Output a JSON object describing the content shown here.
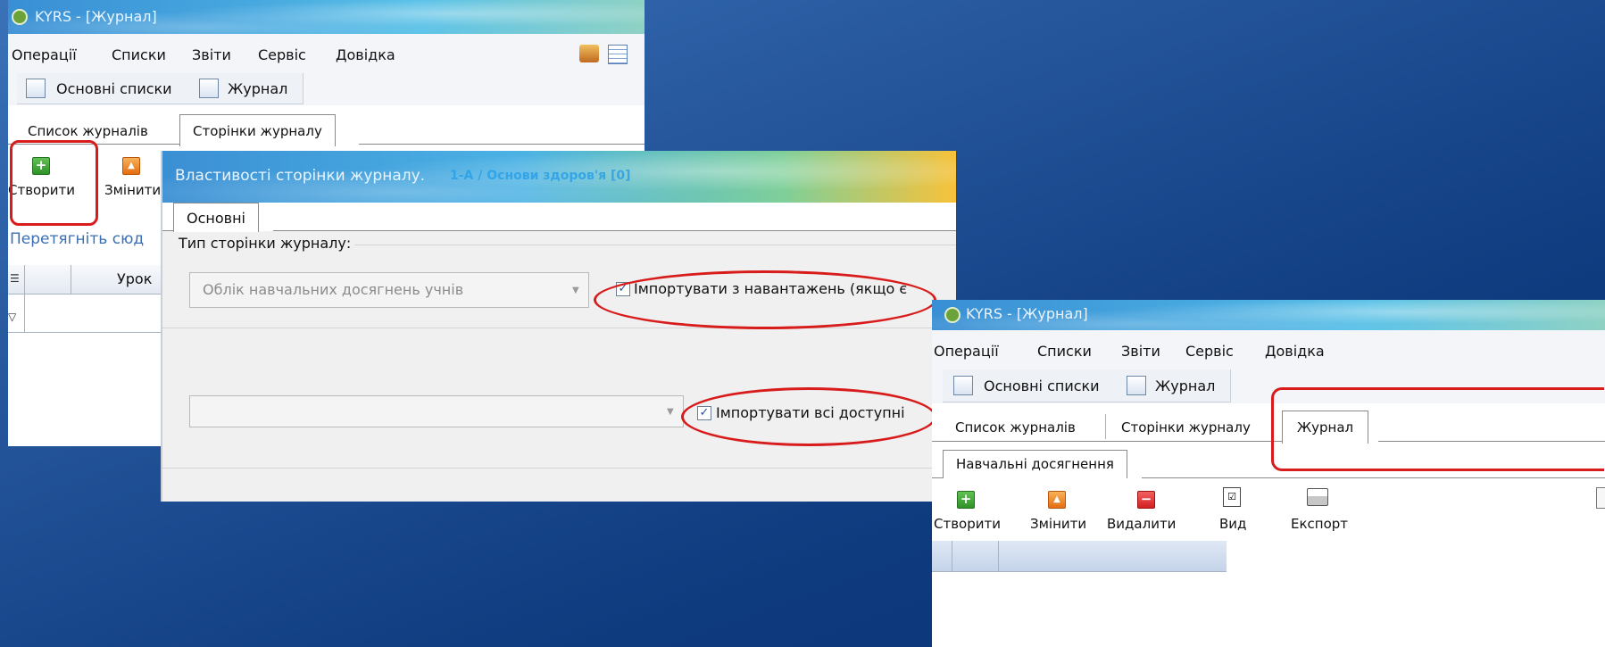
{
  "window1": {
    "title": "KYRS - [Журнал]",
    "menu": [
      "Операції",
      "Списки",
      "Звіти",
      "Сервіс",
      "Довідка"
    ],
    "toolbar_items": [
      "Основні списки",
      "Журнал"
    ],
    "tabs": [
      "Список журналів",
      "Сторінки журналу"
    ],
    "active_tab": "Сторінки журналу",
    "buttons": [
      "Створити",
      "Змінити"
    ],
    "drag_hint": "Перетягніть сюд",
    "column_header": "Урок"
  },
  "dialog": {
    "title": "Властивості сторінки журналу.",
    "title_suffix": "1-А / Основи здоров'я [0]",
    "tab": "Основні",
    "page_type_label": "Тип сторінки журналу:",
    "page_type_value": "Облік навчальних досягнень учнів",
    "checkbox_import_loads": "Імпортувати з навантажень (якщо є",
    "checkbox_import_all": "Імпортувати всі доступні",
    "checkbox_import_loads_checked": true,
    "checkbox_import_all_checked": true
  },
  "window2": {
    "title": "KYRS - [Журнал]",
    "menu": [
      "Операції",
      "Списки",
      "Звіти",
      "Сервіс",
      "Довідка"
    ],
    "toolbar_items": [
      "Основні списки",
      "Журнал"
    ],
    "tabs": [
      "Список журналів",
      "Сторінки журналу",
      "Журнал"
    ],
    "active_tab": "Журнал",
    "subtab": "Навчальні досягнення",
    "buttons": [
      "Створити",
      "Змінити",
      "Видалити",
      "Вид",
      "Експорт"
    ]
  },
  "colors": {
    "highlight": "#d81c1c",
    "accent_blue": "#3a6fb5"
  }
}
